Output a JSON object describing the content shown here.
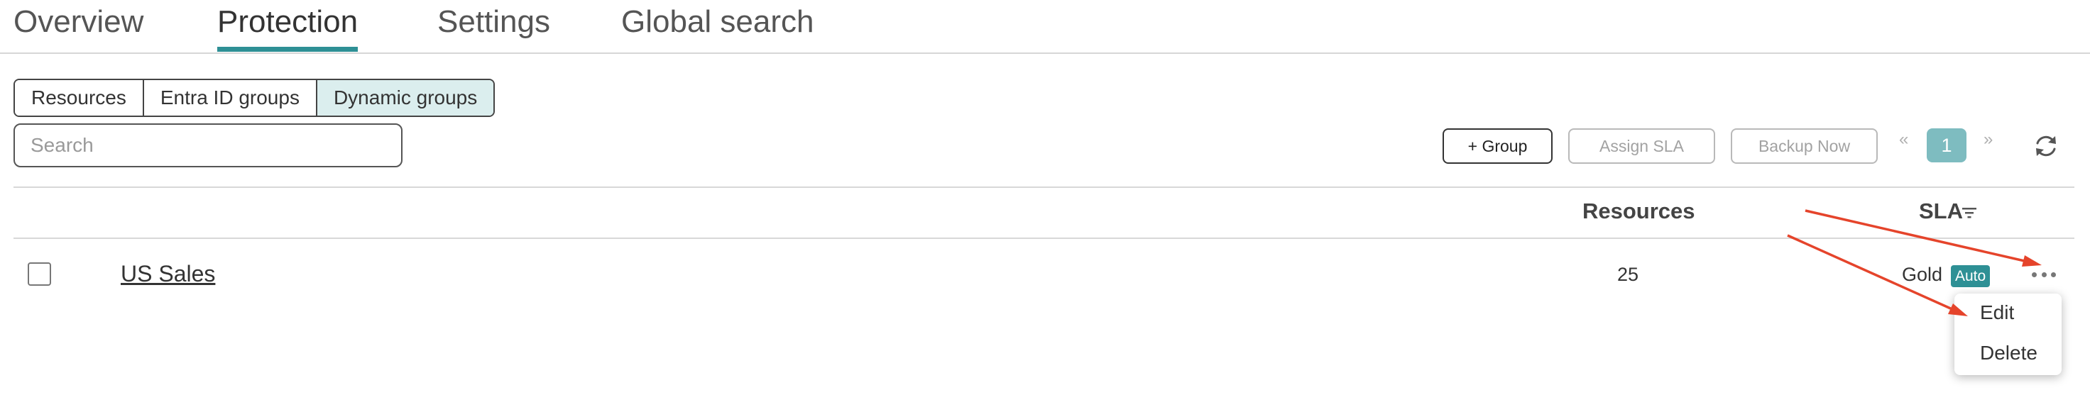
{
  "top_nav": {
    "tabs": [
      {
        "label": "Overview"
      },
      {
        "label": "Protection",
        "active": true
      },
      {
        "label": "Settings"
      },
      {
        "label": "Global search"
      }
    ]
  },
  "segments": [
    {
      "label": "Resources"
    },
    {
      "label": "Entra ID groups"
    },
    {
      "label": "Dynamic groups",
      "active": true
    }
  ],
  "search": {
    "placeholder": "Search",
    "value": ""
  },
  "toolbar": {
    "add_group_label": "+ Group",
    "assign_sla_label": "Assign SLA",
    "backup_now_label": "Backup Now"
  },
  "pagination": {
    "prev": "«",
    "current_page": "1",
    "next": "»"
  },
  "icons": {
    "refresh": "refresh-icon",
    "filter": "filter-icon",
    "more": "more-options-icon"
  },
  "table": {
    "columns": {
      "resources": "Resources",
      "sla": "SLA"
    },
    "rows": [
      {
        "name": "US Sales",
        "resources": "25",
        "sla": "Gold",
        "badge": "Auto"
      }
    ]
  },
  "context_menu": {
    "items": [
      {
        "label": "Edit"
      },
      {
        "label": "Delete"
      }
    ]
  },
  "colors": {
    "accent": "#2e9095",
    "active_page": "#7ebcc0",
    "active_segment_bg": "#dbeeee",
    "annotation_arrow": "#e5442b"
  }
}
